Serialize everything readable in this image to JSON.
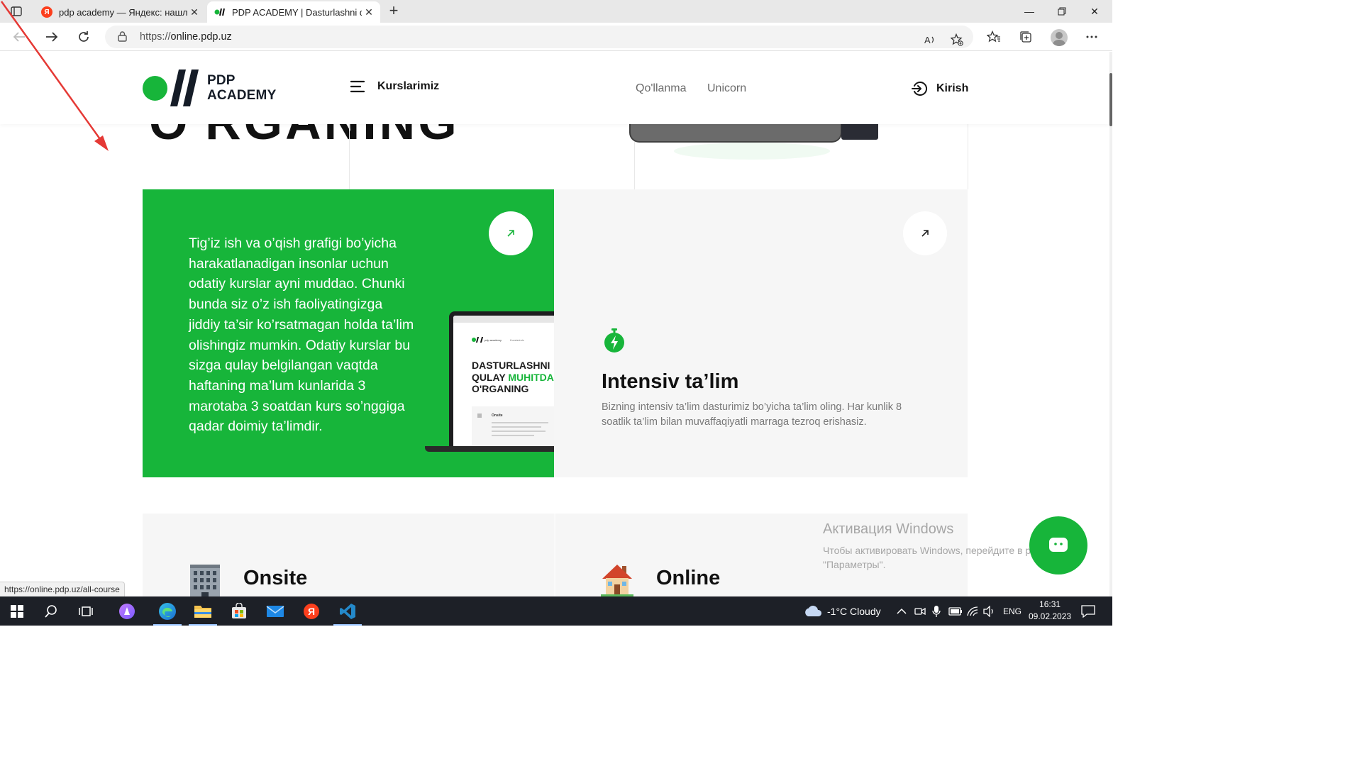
{
  "browser": {
    "tabs": [
      {
        "title": "pdp academy — Яндекс: нашлос",
        "favicon": "yandex-icon",
        "active": false
      },
      {
        "title": "PDP ACADEMY | Dasturlashni qu",
        "favicon": "pdp-icon",
        "active": true
      }
    ],
    "url_scheme": "https://",
    "url_host": "online.pdp.uz"
  },
  "site": {
    "logo_line1": "PDP",
    "logo_line2": "ACADEMY",
    "courses_label": "Kurslarimiz",
    "nav": [
      "Qo'llanma",
      "Unicorn"
    ],
    "login_label": "Kirish",
    "brand_color": "#17b53a"
  },
  "hero_fragment": "O'RGANING",
  "card_green": {
    "text": "Tig’iz ish va o’qish grafigi bo’yicha harakatlanadigan insonlar uchun odatiy kurslar ayni muddao. Chunki bunda siz o’z ish faoliyatingizga jiddiy ta’sir ko’rsatmagan holda ta’lim olishingiz mumkin. Odatiy kurslar bu sizga qulay belgilangan vaqtda haftaning ma’lum kunlarida 3 marotaba 3 soatdan kurs so’nggiga qadar doimiy ta’limdir.",
    "laptop": {
      "logo_text": "pdp academy",
      "nav_text": "Kurslarimiz",
      "headline1": "DASTURLASHNI",
      "headline2a": "QULAY ",
      "headline2b": "MUHITDA",
      "headline3": "O'RGANING",
      "section": "Onsite"
    }
  },
  "card_intensive": {
    "title": "Intensiv ta’lim",
    "description": "Bizning intensiv ta’lim dasturimiz bo’yicha ta’lim oling. Har kunlik 8 soatlik ta’lim bilan muvaffaqiyatli marraga tezroq erishasiz."
  },
  "row2": {
    "onsite_title": "Onsite",
    "online_title": "Online"
  },
  "activation": {
    "title": "Активация Windows",
    "line1": "Чтобы активировать Windows, перейдите в раздел",
    "line2": "\"Параметры\"."
  },
  "status_url": "https://online.pdp.uz/all-course",
  "taskbar": {
    "weather": "-1°C  Cloudy",
    "lang": "ENG",
    "time": "16:31",
    "date": "09.02.2023"
  }
}
